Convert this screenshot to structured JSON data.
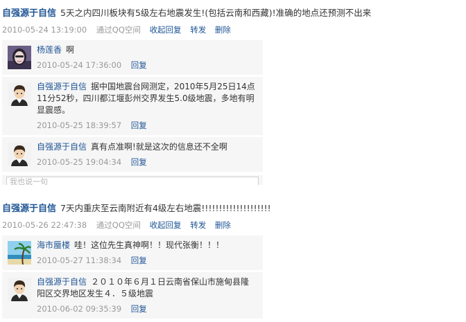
{
  "posts": [
    {
      "author": "自强源于自信",
      "text": "5天之内四川板块有5级左右地震发生!(包括云南和西藏)!准确的地点还预测不出来",
      "time": "2010-05-24 13:19:00",
      "via": "通过QQ空间",
      "actions": {
        "reply": "收起回复",
        "forward": "转发",
        "delete": "删除"
      },
      "replies": [
        {
          "author": "杨莲香",
          "text": "啊",
          "time": "2010-05-24 17:36:00",
          "reply": "回复",
          "avatar": "woman-avatar-icon"
        },
        {
          "author": "自强源于自信",
          "text": "据中国地震台网测定，2010年5月25日14点11分52秒，四川都江堰彭州交界发生5.0级地震，多地有明显震感。",
          "time": "2010-05-25 18:39:57",
          "reply": "回复",
          "avatar": "boy-avatar-icon"
        },
        {
          "author": "自强源于自信",
          "text": "真有点准啊!就是这次的信息还不全啊",
          "time": "2010-05-25 19:04:34",
          "reply": "回复",
          "avatar": "boy-avatar-icon"
        }
      ],
      "reply_placeholder": "我也说一句"
    },
    {
      "author": "自强源于自信",
      "text": "7天内重庆至云南附近有4级左右地震!!!!!!!!!!!!!!!!!!!!",
      "time": "2010-05-26 22:47:38",
      "via": "通过QQ空间",
      "actions": {
        "reply": "收起回复",
        "forward": "转发",
        "delete": "删除"
      },
      "replies": [
        {
          "author": "海市蜃楼",
          "text": "哇！这位先生真神啊！！现代张衡！！！",
          "time": "2010-05-27 11:38:34",
          "reply": "回复",
          "avatar": "beach-avatar-icon"
        },
        {
          "author": "自强源于自信",
          "text": "２０１０年６月１日云南省保山市施甸县隆阳区交界地区发生４．５级地震",
          "time": "2010-06-02 09:35:39",
          "reply": "回复",
          "avatar": "boy-avatar-icon"
        }
      ]
    }
  ]
}
